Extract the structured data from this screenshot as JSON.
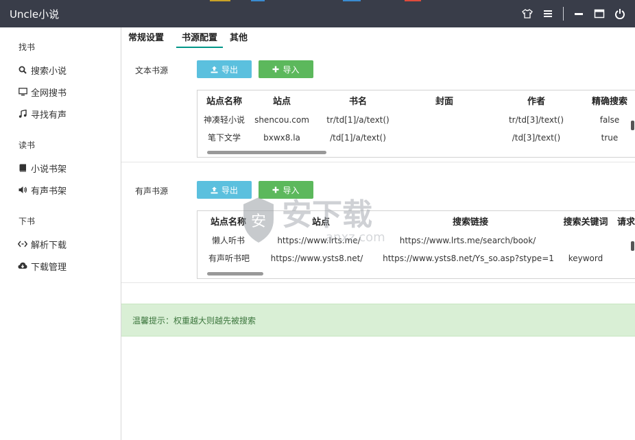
{
  "app": {
    "title": "Uncle小说"
  },
  "titlebar": {
    "icons": [
      "shirt-icon",
      "menu-icon",
      "minimize-icon",
      "maximize-icon",
      "power-icon"
    ],
    "bg_color": "#393d49"
  },
  "sidebar": {
    "groups": [
      {
        "label": "找书",
        "items": [
          {
            "label": "搜索小说",
            "icon": "search-icon"
          },
          {
            "label": "全网搜书",
            "icon": "monitor-icon"
          },
          {
            "label": "寻找有声",
            "icon": "music-icon"
          }
        ]
      },
      {
        "label": "读书",
        "items": [
          {
            "label": "小说书架",
            "icon": "book-icon"
          },
          {
            "label": "有声书架",
            "icon": "volume-icon"
          }
        ]
      },
      {
        "label": "下书",
        "items": [
          {
            "label": "解析下载",
            "icon": "code-icon"
          },
          {
            "label": "下载管理",
            "icon": "cloud-download-icon"
          }
        ]
      }
    ]
  },
  "tabs": [
    {
      "label": "常规设置",
      "active": false
    },
    {
      "label": "书源配置",
      "active": true
    },
    {
      "label": "其他",
      "active": false
    }
  ],
  "text_source": {
    "label": "文本书源",
    "export_label": "导出",
    "import_label": "导入",
    "columns": [
      "站点名称",
      "站点",
      "书名",
      "封面",
      "作者",
      "精确搜索"
    ],
    "rows": [
      [
        "神凑轻小说",
        "shencou.com",
        "tr/td[1]/a/text()",
        "",
        "tr/td[3]/text()",
        "false"
      ],
      [
        "笔下文学",
        "bxwx8.la",
        "/td[1]/a/text()",
        "",
        "/td[3]/text()",
        "true"
      ]
    ]
  },
  "audio_source": {
    "label": "有声书源",
    "export_label": "导出",
    "import_label": "导入",
    "columns": [
      "站点名称",
      "站点",
      "搜索链接",
      "搜索关键词",
      "请求"
    ],
    "rows": [
      [
        "懒人听书",
        "https://www.lrts.me/",
        "https://www.lrts.me/search/book/",
        "",
        ""
      ],
      [
        "有声听书吧",
        "https://www.ysts8.net/",
        "https://www.ysts8.net/Ys_so.asp?stype=1",
        "keyword",
        ""
      ]
    ]
  },
  "tip": {
    "text": "温馨提示：权重越大则越先被搜索"
  },
  "colors": {
    "accent": "#009688",
    "export_btn": "#5bc0de",
    "import_btn": "#5cb85c",
    "tip_bg": "#d9efd5",
    "tip_text": "#3c763d"
  },
  "watermark": {
    "text": "安下载",
    "sub": "anxz.com"
  }
}
